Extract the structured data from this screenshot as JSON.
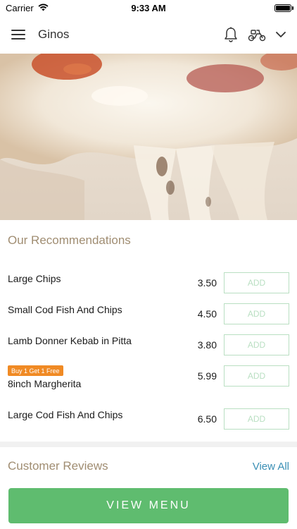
{
  "status": {
    "carrier": "Carrier",
    "time": "9:33 AM"
  },
  "nav": {
    "title": "Ginos",
    "icons": [
      "menu-icon",
      "bell-icon",
      "scooter-icon",
      "chevron-down-icon"
    ]
  },
  "recommendations": {
    "title": "Our Recommendations",
    "add_label": "ADD",
    "items": [
      {
        "name": "Large Chips",
        "price": "3.50",
        "badge": ""
      },
      {
        "name": "Small Cod Fish And Chips",
        "price": "4.50",
        "badge": ""
      },
      {
        "name": "Lamb Donner Kebab in Pitta",
        "price": "3.80",
        "badge": ""
      },
      {
        "name": "8inch Margherita",
        "price": "5.99",
        "badge": "Buy 1 Get 1 Free"
      },
      {
        "name": "Large Cod Fish And Chips",
        "price": "6.50",
        "badge": ""
      }
    ]
  },
  "reviews": {
    "title": "Customer Reviews",
    "view_all": "View All"
  },
  "footer": {
    "view_menu": "VIEW MENU"
  },
  "colors": {
    "accent_green": "#5fbc6f",
    "add_border": "#b9dfc2",
    "section_title": "#a08d72",
    "link_blue": "#3a8fb5",
    "promo_orange": "#f08a24"
  }
}
